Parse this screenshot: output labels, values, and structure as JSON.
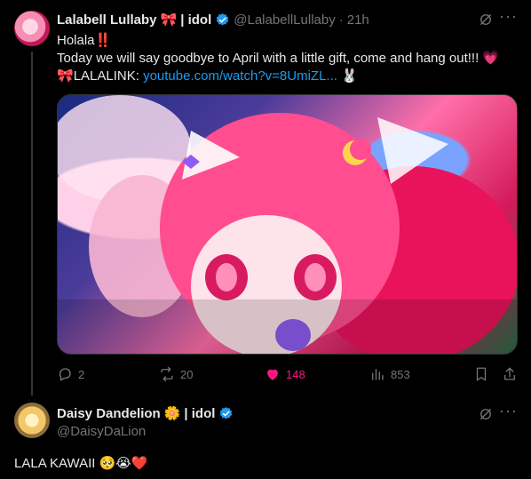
{
  "tweet1": {
    "author_name": "Lalabell Lullaby",
    "author_emoji": "🎀",
    "author_suffix": "| idol",
    "handle": "@LalabellLullaby",
    "separator": "·",
    "time": "21h",
    "line1_text": "Holala",
    "line1_emoji": "‼️",
    "line2": "Today we will say goodbye to April with a little gift, come and hang out!!! 💗",
    "line3_emoji": "🎀",
    "line3_label": "LALALINK:",
    "line3_link": "youtube.com/watch?v=8UmiZL...",
    "line3_trail": "🐰",
    "stats": {
      "replies": "2",
      "reposts": "20",
      "likes": "148",
      "views": "853"
    }
  },
  "tweet2": {
    "author_name": "Daisy Dandelion",
    "author_emoji": "🌼",
    "author_suffix": "| idol",
    "handle": "@DaisyDaLion",
    "text": "LALA KAWAII 🥺😭❤️"
  },
  "colors": {
    "background": "#000000",
    "text": "#e7e9ea",
    "muted": "#71767b",
    "link": "#1d9bf0",
    "like": "#f91880",
    "verified": "#1d9bf0"
  },
  "icons": [
    "grok-icon",
    "more-icon",
    "reply-icon",
    "repost-icon",
    "like-icon",
    "views-icon",
    "bookmark-icon",
    "share-icon",
    "verified-badge-icon"
  ]
}
